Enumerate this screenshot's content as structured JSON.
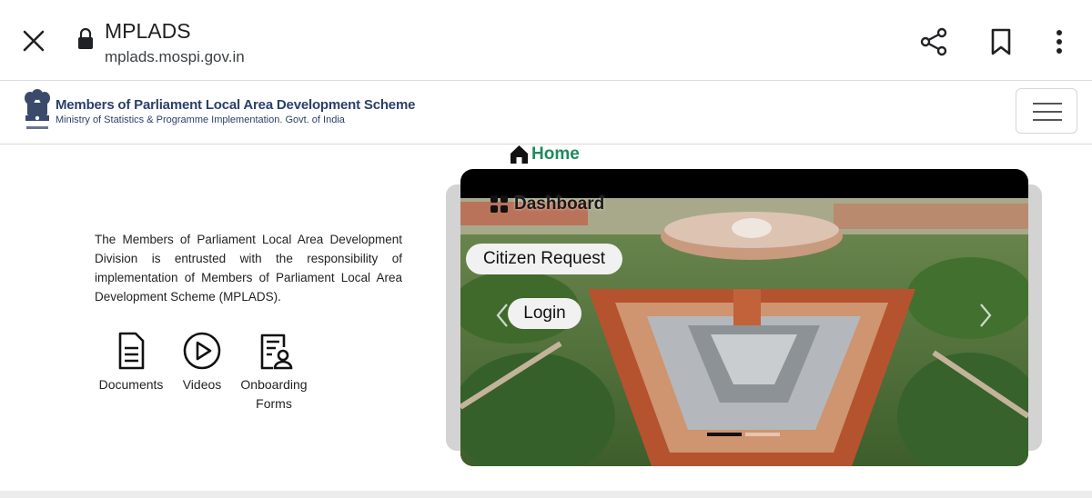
{
  "browser": {
    "title": "MPLADS",
    "url": "mplads.mospi.gov.in"
  },
  "header": {
    "scheme_title": "Members of Parliament Local Area Development Scheme",
    "ministry": "Ministry of Statistics & Programme Implementation. Govt. of India"
  },
  "intro": {
    "text": "The Members of Parliament Local Area Development Division is entrusted with the responsibility of implementation of Members of Parliament Local Area Development Scheme (MPLADS)."
  },
  "quick_links": [
    {
      "label": "Documents",
      "icon": "document-icon"
    },
    {
      "label": "Videos",
      "icon": "play-circle-icon"
    },
    {
      "label": "Onboarding Forms",
      "icon": "form-user-icon"
    }
  ],
  "nav": {
    "home": "Home",
    "dashboard": "Dashboard",
    "citizen_request": "Citizen Request",
    "login": "Login"
  },
  "carousel": {
    "slide_count": 2,
    "active_slide": 1
  },
  "colors": {
    "home_green": "#1f8a63",
    "header_navy": "#2a3f6b",
    "building_red": "#b5532f"
  }
}
